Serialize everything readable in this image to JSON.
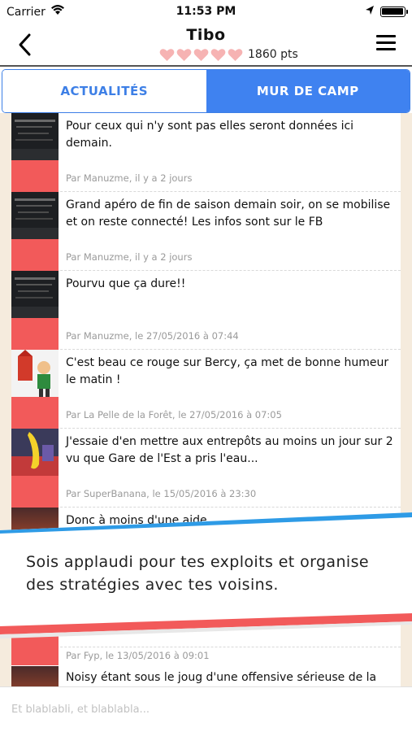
{
  "status_bar": {
    "carrier": "Carrier",
    "time": "11:53 PM"
  },
  "nav": {
    "title": "Tibo",
    "points": "1860 pts",
    "hearts_count": 5
  },
  "tabs": [
    {
      "label": "ACTUALITÉS",
      "active": false
    },
    {
      "label": "MUR DE CAMP",
      "active": true
    }
  ],
  "posts": [
    {
      "text": "Pour ceux qui n'y sont pas elles seront données ici demain.",
      "meta": "Par Manuzme, il y a 2 jours",
      "avatar": "chalkboard-icon"
    },
    {
      "text": "Grand apéro de fin de saison demain soir, on se mobilise et on reste connecté! Les infos sont sur le FB",
      "meta": "Par Manuzme, il y a 2 jours",
      "avatar": "chalkboard-icon"
    },
    {
      "text": "Pourvu que ça dure!!",
      "meta": "Par Manuzme, le 27/05/2016 à 07:44",
      "avatar": "chalkboard-icon"
    },
    {
      "text": "C'est beau ce rouge sur Bercy, ça met de bonne humeur le matin !",
      "meta": "Par La Pelle de la Forêt, le 27/05/2016 à 07:05",
      "avatar": "cartoon-character-icon"
    },
    {
      "text": "J'essaie d'en mettre aux entrepôts au moins un jour sur 2 vu que Gare de l'Est a pris l'eau...",
      "meta": "Par SuperBanana, le 15/05/2016 à 23:30",
      "avatar": "banana-icon"
    },
    {
      "text": "Donc à moins d'une aide",
      "meta": "",
      "avatar": "sunset-icon"
    },
    {
      "text": "",
      "meta": "Par Fyp, le 13/05/2016 à 09:01",
      "avatar": ""
    },
    {
      "text": "Noisy étant sous le joug d'une offensive sérieuse de la",
      "meta": "",
      "avatar": "sunset-icon"
    }
  ],
  "promo": {
    "text": "Sois applaudi pour tes exploits et organise des stratégies avec tes voisins."
  },
  "composer": {
    "placeholder": "Et blablabli, et blablabla..."
  },
  "colors": {
    "accent": "#3f82f0",
    "red": "#f25a5a",
    "heart": "#f6b3b3",
    "sidebar": "#f5ebdd"
  }
}
